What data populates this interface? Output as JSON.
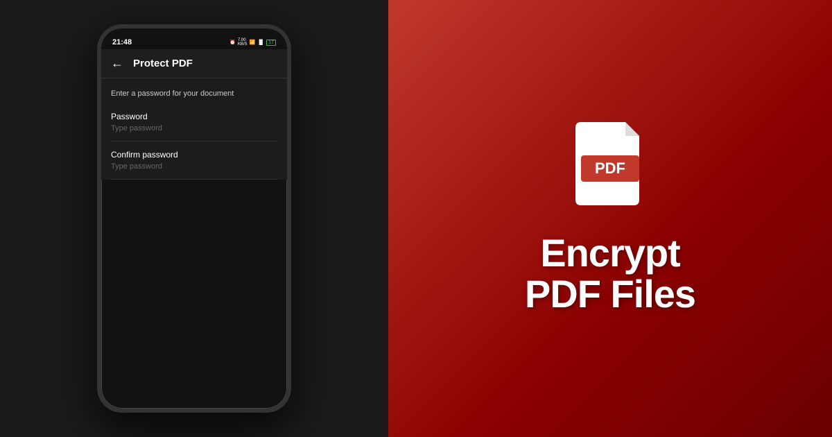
{
  "left": {
    "background_color": "#1a1a1a"
  },
  "phone": {
    "status_bar": {
      "time": "21:48",
      "icons_text": "⏰ 🔔 7.00 KB/S 📶 Vo 📶 🔋"
    },
    "app_bar": {
      "back_label": "←",
      "title": "Protect PDF"
    },
    "screen": {
      "description": "Enter a password for your document",
      "password_field": {
        "label": "Password",
        "placeholder": "Type password"
      },
      "confirm_field": {
        "label": "Confirm password",
        "placeholder": "Type password"
      }
    }
  },
  "right": {
    "pdf_icon_label": "PDF",
    "headline_line1": "Encrypt",
    "headline_line2": "PDF Files",
    "background_gradient_start": "#c0392b",
    "background_gradient_end": "#6b0000"
  }
}
